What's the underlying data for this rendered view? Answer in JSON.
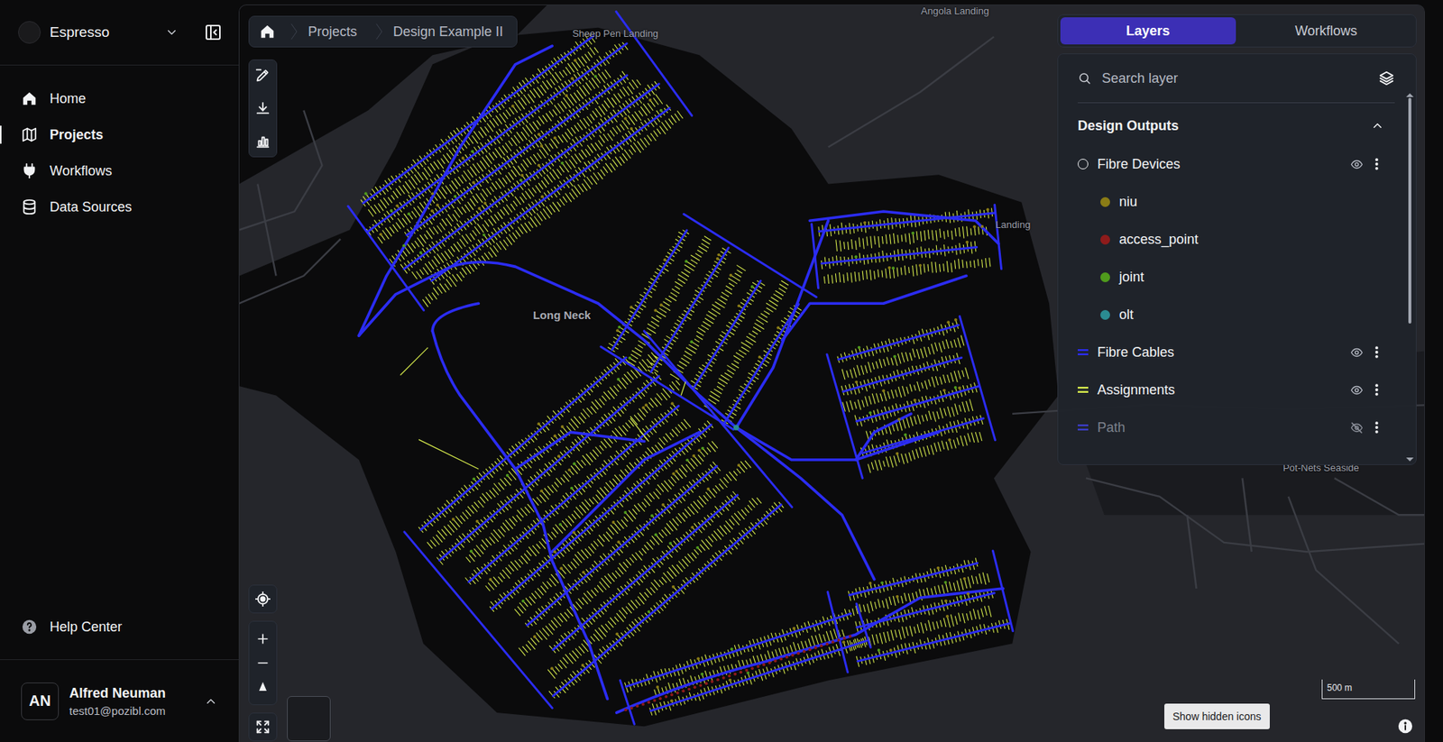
{
  "sidebar": {
    "workspace": "Espresso",
    "items": [
      {
        "label": "Home",
        "selected": false
      },
      {
        "label": "Projects",
        "selected": true
      },
      {
        "label": "Workflows",
        "selected": false
      },
      {
        "label": "Data Sources",
        "selected": false
      }
    ],
    "help": "Help Center",
    "user": {
      "initials": "AN",
      "name": "Alfred Neuman",
      "email": "test01@pozibl.com"
    }
  },
  "breadcrumb": [
    "Projects",
    "Design Example II"
  ],
  "map": {
    "labels": [
      "Angola Landing",
      "Sheep Pen Landing",
      "Long Neck",
      "Landing",
      "Pot-Nets Seaside"
    ],
    "scale": "500 m",
    "tooltip": "Show hidden icons"
  },
  "layers_panel": {
    "tabs": [
      {
        "label": "Layers",
        "selected": true
      },
      {
        "label": "Workflows",
        "selected": false
      }
    ],
    "search": {
      "placeholder": "Search layer"
    },
    "group": {
      "title": "Design Outputs",
      "expanded": true
    },
    "layers": [
      {
        "name": "Fibre Devices",
        "kind": "group",
        "visible": true,
        "children": [
          {
            "name": "niu",
            "color": "#8a7c16"
          },
          {
            "name": "access_point",
            "color": "#8e1b1b"
          },
          {
            "name": "joint",
            "color": "#4f9a1c"
          },
          {
            "name": "olt",
            "color": "#2b8c92"
          }
        ]
      },
      {
        "name": "Fibre Cables",
        "kind": "line",
        "visible": true,
        "color": "#2b2cf2"
      },
      {
        "name": "Assignments",
        "kind": "line",
        "visible": true,
        "color": "#d6ea4c"
      },
      {
        "name": "Path",
        "kind": "line",
        "visible": false,
        "color": "#3b3cc8"
      }
    ]
  }
}
